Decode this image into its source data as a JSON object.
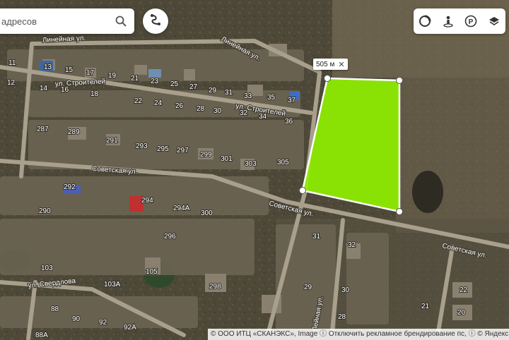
{
  "search": {
    "placeholder_text": "адресов"
  },
  "toolbar": {
    "parking_letter": "P"
  },
  "measure": {
    "distance": "505 м",
    "close": "✕"
  },
  "streets": {
    "lineynaya_1": "Линейная ул.",
    "lineynaya_2": "Линейная ул.",
    "stroiteley_1": "ул. Строителей",
    "stroiteley_2": "ул. Строителей",
    "sovetskaya_1": "Советская ул.",
    "sovetskaya_2": "Советская ул.",
    "sovetskaya_3": "Советская ул.",
    "sverdlova": "ул. Свердлова",
    "vertical": "Лейная ул."
  },
  "houses": [
    "11",
    "13",
    "15",
    "17",
    "19",
    "21",
    "23",
    "25",
    "27",
    "29",
    "31",
    "33",
    "35",
    "37",
    "12",
    "14",
    "16",
    "18",
    "22",
    "24",
    "26",
    "28",
    "30",
    "32",
    "34",
    "36",
    "287",
    "289",
    "291",
    "293",
    "295",
    "297",
    "299",
    "301",
    "303",
    "305",
    "292",
    "294",
    "294А",
    "300",
    "290",
    "296",
    "105",
    "103",
    "103А",
    "298",
    "88",
    "90",
    "92",
    "92А",
    "88А",
    "31",
    "32",
    "29",
    "30",
    "28",
    "21",
    "22",
    "20"
  ],
  "copyright": {
    "provider": "© ООО ИТЦ «СКАНЭКС», Image",
    "disable_ads": "Отключить рекламное брендирование",
    "ps": "пс,",
    "yandex": "© Яндекс Условия и"
  },
  "colors": {
    "plot_fill": "#8ef000",
    "plot_stroke": "#ffffff"
  }
}
